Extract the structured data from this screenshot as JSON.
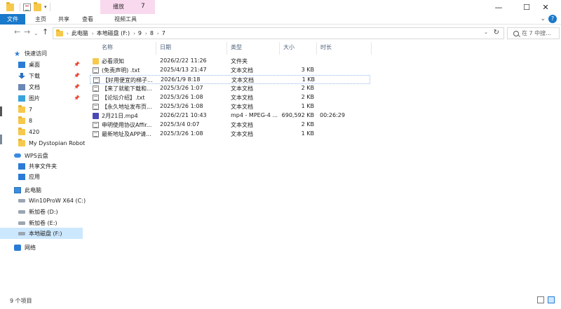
{
  "window": {
    "title": "7",
    "context_tab": "播放",
    "minimize": "—",
    "maximize": "☐",
    "close": "✕"
  },
  "ribbon": {
    "tabs": [
      "文件",
      "主页",
      "共享",
      "查看",
      "视频工具"
    ],
    "expand": "⌄",
    "help": "?"
  },
  "nav": {
    "back": "←",
    "forward": "→",
    "recent": "⌄",
    "up": "↑"
  },
  "address": {
    "crumbs": [
      "此电脑",
      "本地磁盘 (F:)",
      "9",
      "8",
      "7"
    ],
    "separator": "›"
  },
  "search": {
    "placeholder": "在 7 中搜..."
  },
  "sidebar": {
    "items": [
      {
        "label": "快速访问",
        "icon": "star-icon"
      },
      {
        "label": "桌面",
        "icon": "desktop-icon",
        "pinned": true
      },
      {
        "label": "下载",
        "icon": "download-icon",
        "pinned": true
      },
      {
        "label": "文档",
        "icon": "document-icon",
        "pinned": true
      },
      {
        "label": "图片",
        "icon": "pictures-icon",
        "pinned": true
      },
      {
        "label": "7",
        "icon": "folder-icon"
      },
      {
        "label": "8",
        "icon": "folder-icon"
      },
      {
        "label": "420",
        "icon": "folder-icon"
      },
      {
        "label": "My Dystopian Robot",
        "icon": "folder-icon"
      },
      {
        "label": "WPS云盘",
        "icon": "cloud-icon"
      },
      {
        "label": "共享文件夹",
        "icon": "shared-folder-icon"
      },
      {
        "label": "应用",
        "icon": "apps-icon"
      },
      {
        "label": "此电脑",
        "icon": "computer-icon"
      },
      {
        "label": "Win10ProW X64 (C:)",
        "icon": "drive-icon"
      },
      {
        "label": "新加卷 (D:)",
        "icon": "drive-icon"
      },
      {
        "label": "新加卷 (E:)",
        "icon": "drive-icon"
      },
      {
        "label": "本地磁盘 (F:)",
        "icon": "drive-icon",
        "selected": true
      },
      {
        "label": "网络",
        "icon": "network-icon"
      }
    ],
    "pin_glyph": "📌"
  },
  "columns": [
    "名称",
    "日期",
    "类型",
    "大小",
    "时长"
  ],
  "files": [
    {
      "name": "必看须知",
      "date": "2026/2/22 11:26",
      "type": "文件夹",
      "size": "",
      "duration": "",
      "icon": "folder-icon"
    },
    {
      "name": "(免责声明) .txt",
      "date": "2025/4/13 21:47",
      "type": "文本文档",
      "size": "3 KB",
      "duration": "",
      "icon": "text-file-icon"
    },
    {
      "name": "【好用便宜的梯子...",
      "date": "2026/1/9 8:18",
      "type": "文本文档",
      "size": "1 KB",
      "duration": "",
      "icon": "text-file-icon",
      "selected": true
    },
    {
      "name": "【来了就能下载和...",
      "date": "2025/3/26 1:07",
      "type": "文本文档",
      "size": "2 KB",
      "duration": "",
      "icon": "text-file-icon"
    },
    {
      "name": "【论坛介绍】.txt",
      "date": "2025/3/26 1:08",
      "type": "文本文档",
      "size": "2 KB",
      "duration": "",
      "icon": "text-file-icon"
    },
    {
      "name": "【永久地址发布页...",
      "date": "2025/3/26 1:08",
      "type": "文本文档",
      "size": "1 KB",
      "duration": "",
      "icon": "text-file-icon"
    },
    {
      "name": "2月21日.mp4",
      "date": "2026/2/21 10:43",
      "type": "mp4 - MPEG-4 ...",
      "size": "690,592 KB",
      "duration": "00:26:29",
      "icon": "video-file-icon"
    },
    {
      "name": "申明使用协议Affir...",
      "date": "2025/3/4 0:07",
      "type": "文本文档",
      "size": "2 KB",
      "duration": "",
      "icon": "text-file-icon"
    },
    {
      "name": "最新地址及APP请...",
      "date": "2025/3/26 1:08",
      "type": "文本文档",
      "size": "1 KB",
      "duration": "",
      "icon": "text-file-icon"
    }
  ],
  "statusbar": {
    "item_count": "9 个项目"
  }
}
